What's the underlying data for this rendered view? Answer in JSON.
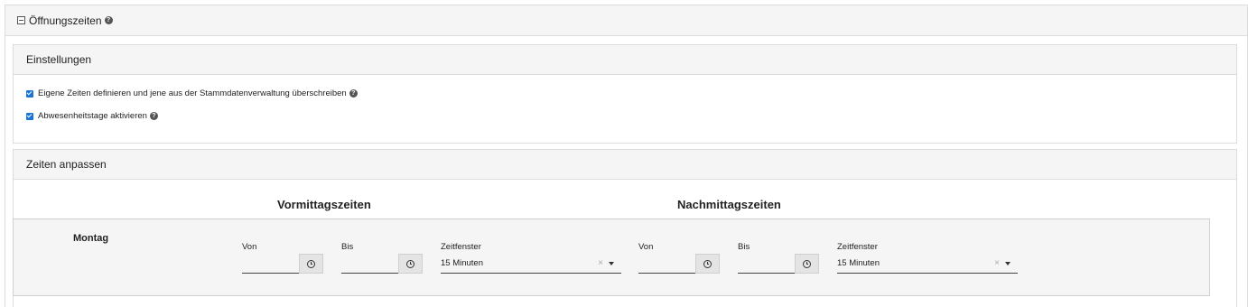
{
  "section": {
    "title": "Öffnungszeiten"
  },
  "settings": {
    "title": "Einstellungen",
    "options": [
      {
        "label": "Eigene Zeiten definieren und jene aus der Stammdatenverwaltung überschreiben",
        "checked": true
      },
      {
        "label": "Abwesenheitstage aktivieren",
        "checked": true
      }
    ]
  },
  "times": {
    "title": "Zeiten anpassen",
    "morning_title": "Vormittagszeiten",
    "afternoon_title": "Nachmittagszeiten",
    "day": "Montag",
    "morning": {
      "from_label": "Von",
      "to_label": "Bis",
      "window_label": "Zeitfenster",
      "window_value": "15 Minuten"
    },
    "afternoon": {
      "from_label": "Von",
      "to_label": "Bis",
      "window_label": "Zeitfenster",
      "window_value": "15 Minuten"
    }
  },
  "help_glyph": "?",
  "clear_glyph": "×",
  "icons": {
    "toggle": "collapse-icon",
    "help": "help-icon",
    "clock": "clock-icon",
    "caret": "caret-down-icon",
    "checkbox": "checkbox-checked"
  },
  "colors": {
    "accent": "#1a73d9",
    "header_bg": "#f5f5f5",
    "border": "#dcdcdc"
  }
}
